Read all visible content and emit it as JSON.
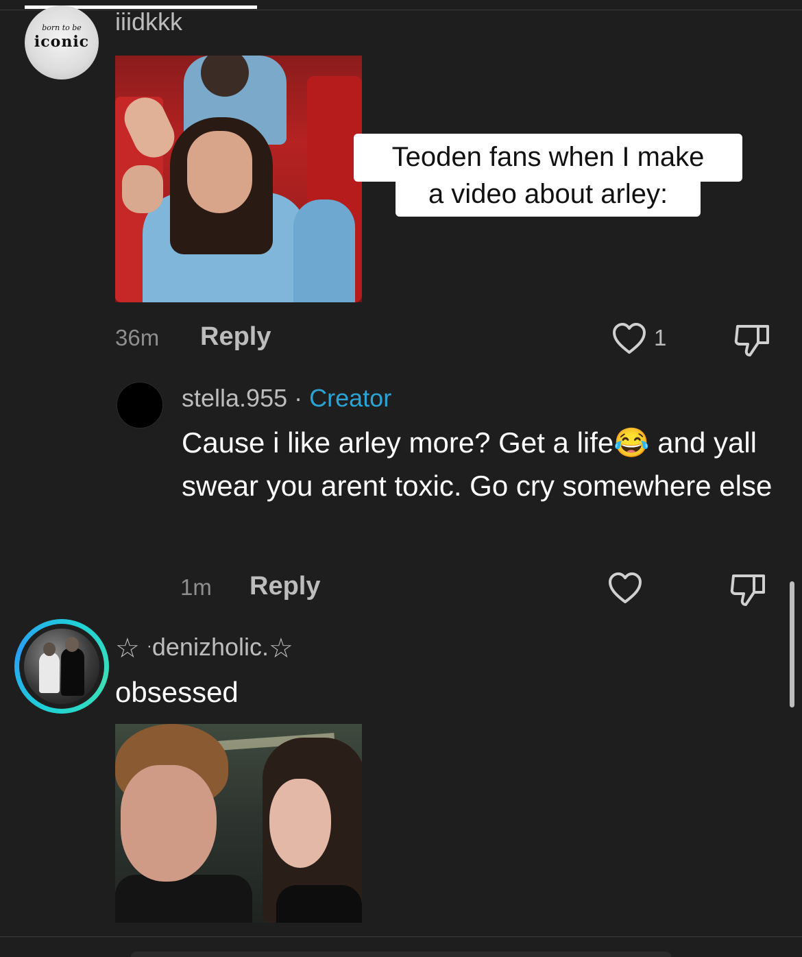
{
  "comments": [
    {
      "avatar": {
        "line1": "born to be",
        "line2": "iconic"
      },
      "username": "iiidkkk",
      "image_caption": {
        "line1": "Teoden fans when I make",
        "line2": "a video about arley:"
      },
      "time": "36m",
      "reply_label": "Reply",
      "like_count": "1"
    },
    {
      "username": "stella.955",
      "separator": "·",
      "badge": "Creator",
      "text_before_emoji": "Cause i like arley more? Get a life",
      "emoji": "😂",
      "text_after_emoji": " and yall swear you arent toxic. Go cry somewhere else",
      "time": "1m",
      "reply_label": "Reply"
    },
    {
      "username_prefix_star": "☆",
      "username_dot": "·",
      "username": "denizholic.",
      "username_suffix_star": "☆",
      "text": "obsessed"
    }
  ],
  "icons": {
    "like": "heart-outline-icon",
    "dislike": "thumbs-down-outline-icon"
  },
  "colors": {
    "background": "#1e1e1e",
    "creator_badge": "#2ba3d4",
    "story_ring": "#1fd1d6"
  }
}
